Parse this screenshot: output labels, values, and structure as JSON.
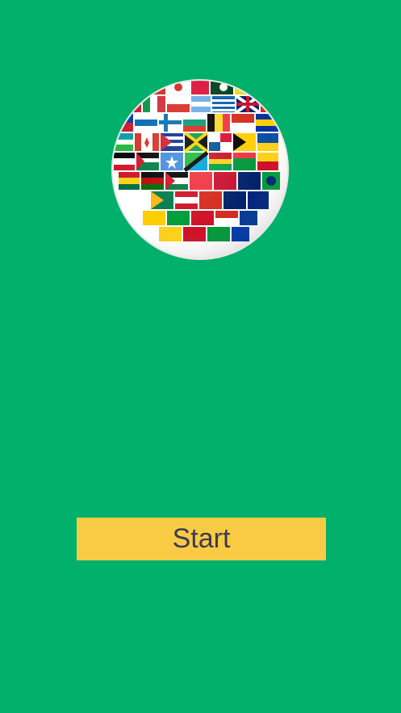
{
  "app": {
    "background_color": "#00b06b",
    "logo_icon": "world-flags-globe-icon"
  },
  "start_button": {
    "label": "Start",
    "color": "#f9cb45",
    "text_color": "#3d3a55"
  }
}
